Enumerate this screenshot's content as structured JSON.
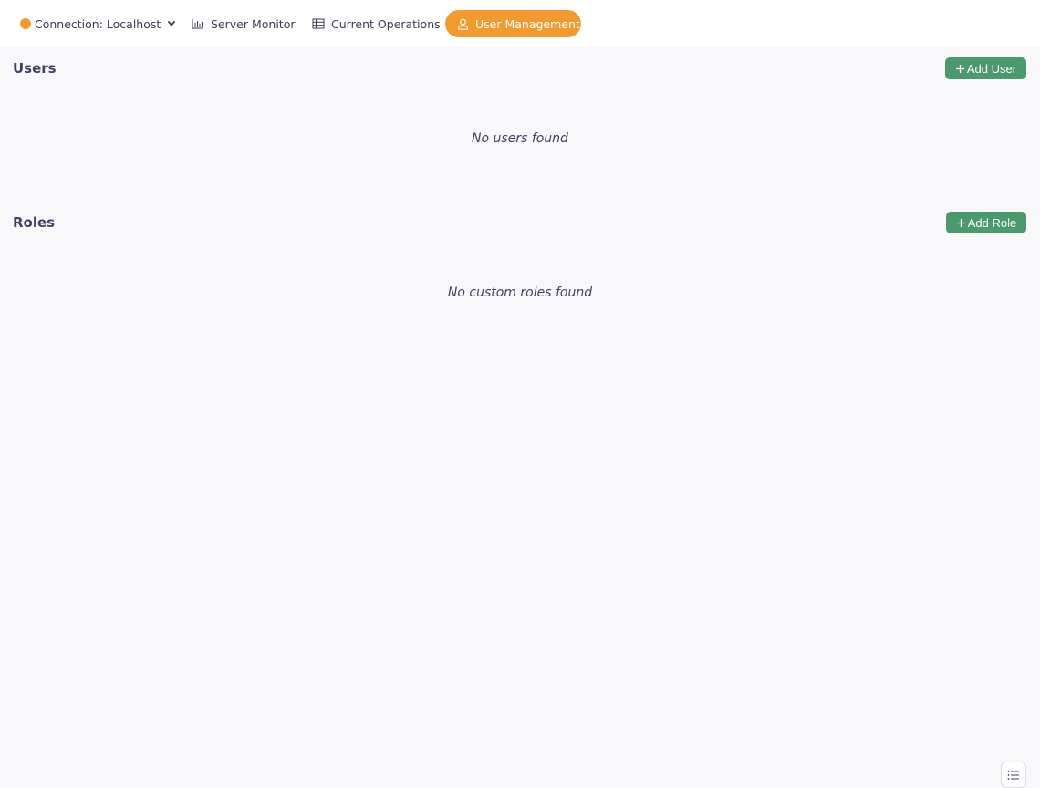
{
  "topbar": {
    "connection": {
      "label": "Connection: Localhost",
      "status_color": "#f39a2e",
      "icon": "chevron-down-icon"
    },
    "tabs": [
      {
        "label": "Server Monitor",
        "icon": "bar-chart-icon",
        "active": false
      },
      {
        "label": "Current Operations",
        "icon": "operations-list-icon",
        "active": false
      },
      {
        "label": "User Management",
        "icon": "user-icon",
        "active": true
      }
    ]
  },
  "users": {
    "title": "Users",
    "add_button": "Add User",
    "empty_message": "No users found"
  },
  "roles": {
    "title": "Roles",
    "add_button": "Add Role",
    "empty_message": "No custom roles found"
  },
  "colors": {
    "accent": "#f39a2e",
    "add_button": "#4b9a6c",
    "background": "#f8f8fb"
  },
  "floating": {
    "icon": "list-icon"
  }
}
